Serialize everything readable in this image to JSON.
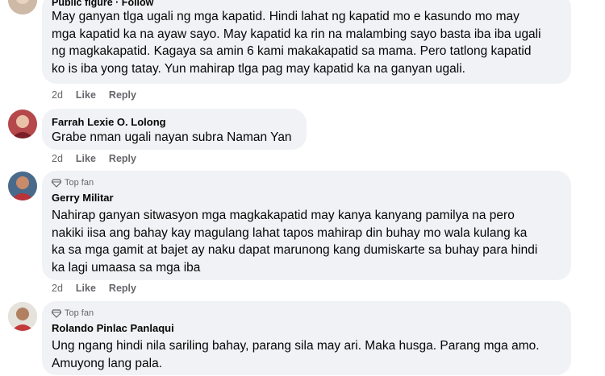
{
  "comments": [
    {
      "header": "Public figure · Follow",
      "lines": [
        "May ganyan tlga ugali ng mga kapatid. Hindi lahat ng kapatid mo e kasundo mo may",
        "mga kapatid ka na ayaw sayo. May kapatid ka rin na malambing sayo basta iba iba ugali",
        "ng magkakapatid. Kagaya sa amin 6 kami makakapatid sa mama. Pero tatlong kapatid",
        "ko is iba yong tatay. Yun mahirap tlga pag may kapatid ka na ganyan ugali."
      ],
      "time": "2d",
      "like": "Like",
      "reply": "Reply"
    },
    {
      "author": "Farrah Lexie O. Lolong",
      "lines": [
        "Grabe nman ugali nayan subra Naman Yan"
      ],
      "time": "2d",
      "like": "Like",
      "reply": "Reply"
    },
    {
      "badge": "Top fan",
      "author": "Gerry Militar",
      "lines": [
        "Nahirap ganyan sitwasyon mga magkakapatid may kanya kanyang pamilya na pero",
        "nakiki iisa ang bahay kay magulang lahat tapos mahirap din buhay mo wala kulang ka",
        "ka sa mga gamit at bajet ay naku dapat marunong kang dumiskarte sa buhay para hindi",
        "ka lagi umaasa sa mga iba"
      ],
      "time": "2d",
      "like": "Like",
      "reply": "Reply"
    },
    {
      "badge": "Top fan",
      "author": "Rolando Pinlac Panlaqui",
      "lines": [
        "Ung ngang hindi nila sariling bahay, parang sila may ari. Maka husga. Parang mga amo.",
        "Amuyong lang pala."
      ]
    }
  ]
}
